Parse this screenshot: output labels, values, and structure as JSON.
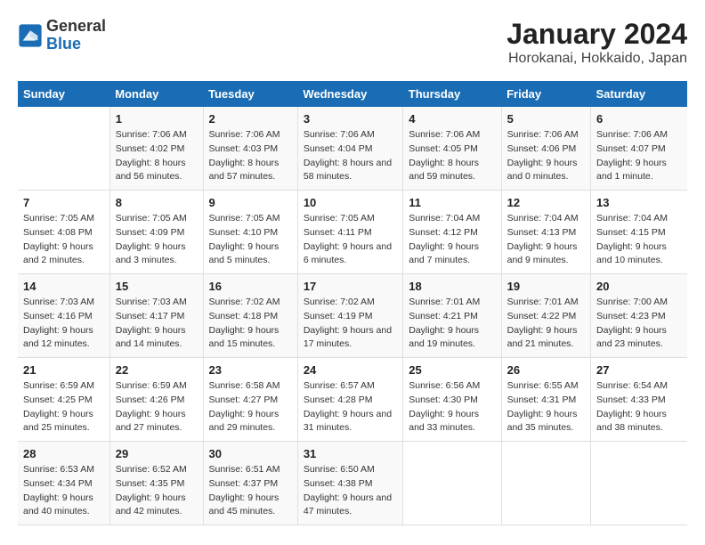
{
  "logo": {
    "text_general": "General",
    "text_blue": "Blue"
  },
  "title": "January 2024",
  "subtitle": "Horokanai, Hokkaido, Japan",
  "weekdays": [
    "Sunday",
    "Monday",
    "Tuesday",
    "Wednesday",
    "Thursday",
    "Friday",
    "Saturday"
  ],
  "weeks": [
    [
      null,
      {
        "day": 1,
        "sunrise": "7:06 AM",
        "sunset": "4:02 PM",
        "daylight": "8 hours and 56 minutes."
      },
      {
        "day": 2,
        "sunrise": "7:06 AM",
        "sunset": "4:03 PM",
        "daylight": "8 hours and 57 minutes."
      },
      {
        "day": 3,
        "sunrise": "7:06 AM",
        "sunset": "4:04 PM",
        "daylight": "8 hours and 58 minutes."
      },
      {
        "day": 4,
        "sunrise": "7:06 AM",
        "sunset": "4:05 PM",
        "daylight": "8 hours and 59 minutes."
      },
      {
        "day": 5,
        "sunrise": "7:06 AM",
        "sunset": "4:06 PM",
        "daylight": "9 hours and 0 minutes."
      },
      {
        "day": 6,
        "sunrise": "7:06 AM",
        "sunset": "4:07 PM",
        "daylight": "9 hours and 1 minute."
      }
    ],
    [
      {
        "day": 7,
        "sunrise": "7:05 AM",
        "sunset": "4:08 PM",
        "daylight": "9 hours and 2 minutes."
      },
      {
        "day": 8,
        "sunrise": "7:05 AM",
        "sunset": "4:09 PM",
        "daylight": "9 hours and 3 minutes."
      },
      {
        "day": 9,
        "sunrise": "7:05 AM",
        "sunset": "4:10 PM",
        "daylight": "9 hours and 5 minutes."
      },
      {
        "day": 10,
        "sunrise": "7:05 AM",
        "sunset": "4:11 PM",
        "daylight": "9 hours and 6 minutes."
      },
      {
        "day": 11,
        "sunrise": "7:04 AM",
        "sunset": "4:12 PM",
        "daylight": "9 hours and 7 minutes."
      },
      {
        "day": 12,
        "sunrise": "7:04 AM",
        "sunset": "4:13 PM",
        "daylight": "9 hours and 9 minutes."
      },
      {
        "day": 13,
        "sunrise": "7:04 AM",
        "sunset": "4:15 PM",
        "daylight": "9 hours and 10 minutes."
      }
    ],
    [
      {
        "day": 14,
        "sunrise": "7:03 AM",
        "sunset": "4:16 PM",
        "daylight": "9 hours and 12 minutes."
      },
      {
        "day": 15,
        "sunrise": "7:03 AM",
        "sunset": "4:17 PM",
        "daylight": "9 hours and 14 minutes."
      },
      {
        "day": 16,
        "sunrise": "7:02 AM",
        "sunset": "4:18 PM",
        "daylight": "9 hours and 15 minutes."
      },
      {
        "day": 17,
        "sunrise": "7:02 AM",
        "sunset": "4:19 PM",
        "daylight": "9 hours and 17 minutes."
      },
      {
        "day": 18,
        "sunrise": "7:01 AM",
        "sunset": "4:21 PM",
        "daylight": "9 hours and 19 minutes."
      },
      {
        "day": 19,
        "sunrise": "7:01 AM",
        "sunset": "4:22 PM",
        "daylight": "9 hours and 21 minutes."
      },
      {
        "day": 20,
        "sunrise": "7:00 AM",
        "sunset": "4:23 PM",
        "daylight": "9 hours and 23 minutes."
      }
    ],
    [
      {
        "day": 21,
        "sunrise": "6:59 AM",
        "sunset": "4:25 PM",
        "daylight": "9 hours and 25 minutes."
      },
      {
        "day": 22,
        "sunrise": "6:59 AM",
        "sunset": "4:26 PM",
        "daylight": "9 hours and 27 minutes."
      },
      {
        "day": 23,
        "sunrise": "6:58 AM",
        "sunset": "4:27 PM",
        "daylight": "9 hours and 29 minutes."
      },
      {
        "day": 24,
        "sunrise": "6:57 AM",
        "sunset": "4:28 PM",
        "daylight": "9 hours and 31 minutes."
      },
      {
        "day": 25,
        "sunrise": "6:56 AM",
        "sunset": "4:30 PM",
        "daylight": "9 hours and 33 minutes."
      },
      {
        "day": 26,
        "sunrise": "6:55 AM",
        "sunset": "4:31 PM",
        "daylight": "9 hours and 35 minutes."
      },
      {
        "day": 27,
        "sunrise": "6:54 AM",
        "sunset": "4:33 PM",
        "daylight": "9 hours and 38 minutes."
      }
    ],
    [
      {
        "day": 28,
        "sunrise": "6:53 AM",
        "sunset": "4:34 PM",
        "daylight": "9 hours and 40 minutes."
      },
      {
        "day": 29,
        "sunrise": "6:52 AM",
        "sunset": "4:35 PM",
        "daylight": "9 hours and 42 minutes."
      },
      {
        "day": 30,
        "sunrise": "6:51 AM",
        "sunset": "4:37 PM",
        "daylight": "9 hours and 45 minutes."
      },
      {
        "day": 31,
        "sunrise": "6:50 AM",
        "sunset": "4:38 PM",
        "daylight": "9 hours and 47 minutes."
      },
      null,
      null,
      null
    ]
  ]
}
